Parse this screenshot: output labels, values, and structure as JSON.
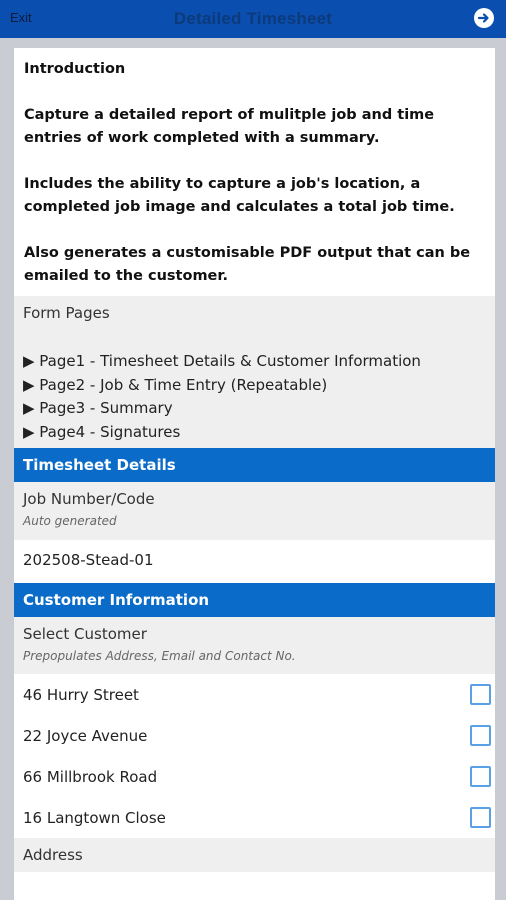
{
  "header": {
    "exit_label": "Exit",
    "title": "Detailed Timesheet",
    "next_icon": "arrow-right-circle-icon"
  },
  "intro": {
    "heading": "Introduction",
    "para1": "Capture a detailed report of mulitple job and time entries of work completed with a summary.",
    "para2": "Includes the ability to capture a job's location, a completed job image and calculates a total job time.",
    "para3": "Also generates a customisable PDF output that can be emailed to the customer."
  },
  "form_pages": {
    "label": "Form Pages",
    "items": [
      "▶ Page1 - Timesheet Details & Customer Information",
      "▶ Page2 - Job & Time Entry (Repeatable)",
      "▶ Page3 - Summary",
      "▶ Page4 - Signatures"
    ]
  },
  "timesheet_details": {
    "heading": "Timesheet Details",
    "job_label": "Job Number/Code",
    "job_hint": "Auto generated",
    "job_value": "202508-Stead-01"
  },
  "customer_info": {
    "heading": "Customer Information",
    "select_label": "Select Customer",
    "select_hint": "Prepopulates Address, Email and Contact No.",
    "options": [
      "46 Hurry Street",
      "22 Joyce Avenue",
      "66 Millbrook Road",
      "16 Langtown Close"
    ],
    "address_label": "Address"
  },
  "colors": {
    "topbar": "#0a4fb0",
    "section_header": "#0a6cc8",
    "checkbox_border": "#5aa0e6"
  }
}
